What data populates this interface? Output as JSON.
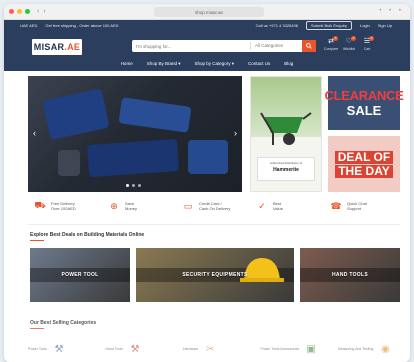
{
  "browser": {
    "url": "shop.misar.ae",
    "controls": "• • •"
  },
  "topbar": {
    "currency": "UAE AED",
    "shipping": "Get free shipping - Order above 100 AED",
    "phone": "Call us +971 4 3325496",
    "bulk": "Submit Bulk Enquiry",
    "login": "Login",
    "signup": "Sign Up"
  },
  "header": {
    "logo_main": "MISAR",
    "logo_accent": ".AE",
    "search_placeholder": "I'm shopping for...",
    "search_category": "All Categories",
    "icons": [
      {
        "name": "compare",
        "label": "Compare",
        "glyph": "⇄",
        "count": "0"
      },
      {
        "name": "wishlist",
        "label": "Wishlist",
        "glyph": "♡",
        "count": "0"
      },
      {
        "name": "cart",
        "label": "Cart",
        "glyph": "☱",
        "count": "0"
      }
    ]
  },
  "menu": [
    "Home",
    "Shop By Brand ▾",
    "Shop by Category ▾",
    "Contact Us",
    "Blog"
  ],
  "hero": {
    "prev": "‹",
    "next": "›"
  },
  "promo": {
    "line": "Authorized Distributor of",
    "brand": "Hammerite"
  },
  "clearance": {
    "line1": "CLEARANCE",
    "line2": "SALE"
  },
  "deal": {
    "line1": "DEAL OF",
    "line2": "THE DAY"
  },
  "features": [
    {
      "icon": "⛟",
      "name": "delivery",
      "line1": "Free Delivery",
      "line2": "Over 100AED"
    },
    {
      "icon": "⊕",
      "name": "save-money",
      "line1": "Save",
      "line2": "Money"
    },
    {
      "icon": "▭",
      "name": "card",
      "line1": "Credit Card /",
      "line2": "Cash On Delivery"
    },
    {
      "icon": "✓",
      "name": "value",
      "line1": "Best",
      "line2": "Value"
    },
    {
      "icon": "☎",
      "name": "support",
      "line1": "Quick Chat",
      "line2": "Support"
    }
  ],
  "sections": {
    "explore": "Explore Best Deals on Building Materials Online",
    "best": "Our Best Selling Categories"
  },
  "categories": [
    {
      "label": "POWER TOOL",
      "bg": "#6e7a8c"
    },
    {
      "label": "SECURITY EQUIPMENTS",
      "bg": "#8a7a52"
    },
    {
      "label": "HAND TOOLS",
      "bg": "#7d5c50"
    }
  ],
  "best_items": [
    {
      "label": "Power Tools",
      "glyph": "⚒",
      "color": "#2d5aa8"
    },
    {
      "label": "Hand Tools",
      "glyph": "⚒",
      "color": "#c0392b"
    },
    {
      "label": "Hardware",
      "glyph": "✂",
      "color": "#d9892b"
    },
    {
      "label": "Power Tools Accessories",
      "glyph": "▣",
      "color": "#3c8a3c"
    },
    {
      "label": "Measuring And Testing",
      "glyph": "◉",
      "color": "#e08a1e"
    }
  ]
}
